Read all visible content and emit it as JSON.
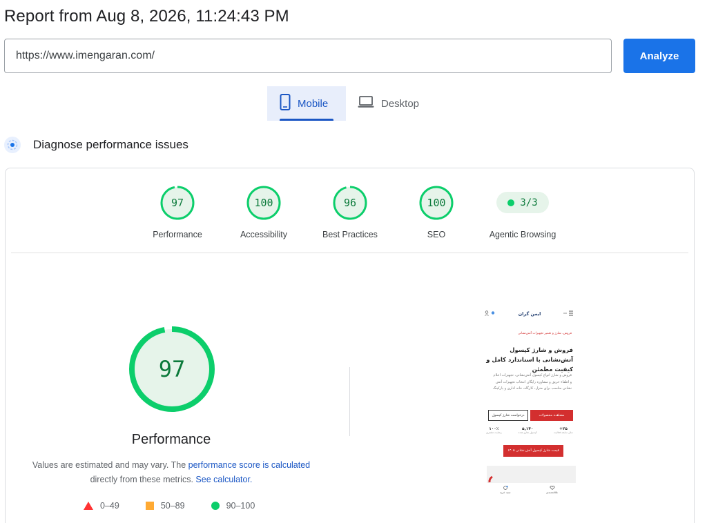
{
  "header": {
    "report_title": "Report from Aug 8, 2026, 11:24:43 PM"
  },
  "url_bar": {
    "value": "https://www.imengaran.com/",
    "analyze_label": "Analyze"
  },
  "device_tabs": {
    "mobile_label": "Mobile",
    "desktop_label": "Desktop",
    "selected": "Mobile"
  },
  "diagnose": {
    "title": "Diagnose performance issues"
  },
  "categories": [
    {
      "label": "Performance",
      "score": 97
    },
    {
      "label": "Accessibility",
      "score": 100
    },
    {
      "label": "Best Practices",
      "score": 96
    },
    {
      "label": "SEO",
      "score": 100
    },
    {
      "label": "Agentic Browsing",
      "score_text": "3/3"
    }
  ],
  "performance_detail": {
    "score": 97,
    "title": "Performance",
    "desc_prefix": "Values are estimated and may vary. The ",
    "desc_link1": "performance score is calculated",
    "desc_mid": " directly from these metrics. ",
    "desc_link2": "See calculator.",
    "legend": [
      {
        "range": "0–49",
        "color": "#ff3333"
      },
      {
        "range": "50–89",
        "color": "#ffaa33"
      },
      {
        "range": "90–100",
        "color": "#0cce6b"
      }
    ]
  },
  "colors": {
    "pass_green": "#0cce6b",
    "pass_text": "#0c7a3b",
    "pass_fill": "#e6f4ea",
    "accent_blue": "#1a73e8"
  },
  "phone_preview": {
    "logo": "ایمن گران",
    "breadcrumb": "فروش، شارژ و تعمیر تجهیزات آتش‌نشانی",
    "headline": "فروش و شارژ کپسول آتش‌نشانی با استاندارد کامل و کیفیت مطمئن",
    "paragraph": "فروش و شارژ انواع کپسول آتش‌نشانی، تجهیزات اعلام و اطفاء حریق و مشاوره رایگان انتخاب تجهیزات آتش نشانی مناسب برای منزل، کارگاه، خانه اداری و پارکینگ",
    "btn_primary": "مشاهده محصولات",
    "btn_secondary": "درخواست شارژ کپسول",
    "stats": [
      {
        "num": "۲۵+",
        "label": "سال سابقه فعالیت"
      },
      {
        "num": "۵,۱۴۰",
        "label": "کپسول شارژ شده"
      },
      {
        "num": "۱۰۰٪",
        "label": "رضایت مشتری"
      }
    ],
    "btn_wide": "قیمت شارژ کپسول آتش نشانی ۱۴۰۵",
    "nav_left": "سبد خرید",
    "nav_right": "علاقه‌مندی"
  }
}
